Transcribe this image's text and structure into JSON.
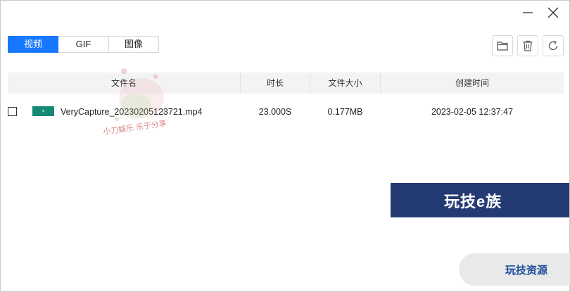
{
  "window": {
    "controls": {
      "minimize_icon": "minimize-icon",
      "close_icon": "close-icon"
    }
  },
  "tabs": [
    {
      "label": "视频",
      "active": true
    },
    {
      "label": "GIF",
      "active": false
    },
    {
      "label": "图像",
      "active": false
    }
  ],
  "toolbar": {
    "folder_icon": "folder-icon",
    "delete_icon": "trash-icon",
    "refresh_icon": "refresh-icon"
  },
  "table": {
    "columns": [
      "文件名",
      "时长",
      "文件大小",
      "创建时间"
    ],
    "rows": [
      {
        "checked": false,
        "filename": "VeryCapture_20230205123721.mp4",
        "duration": "23.000S",
        "size": "0.177MB",
        "created": "2023-02-05 12:37:47"
      }
    ]
  },
  "overlays": {
    "watermark_left": "小刀娱乐 乐于分享",
    "banner": "玩技e族",
    "pill": "玩技资源"
  },
  "colors": {
    "accent": "#1677ff",
    "thumbnail": "#148a75",
    "banner_bg": "#243a73",
    "pill_text": "#1d4c9c"
  }
}
